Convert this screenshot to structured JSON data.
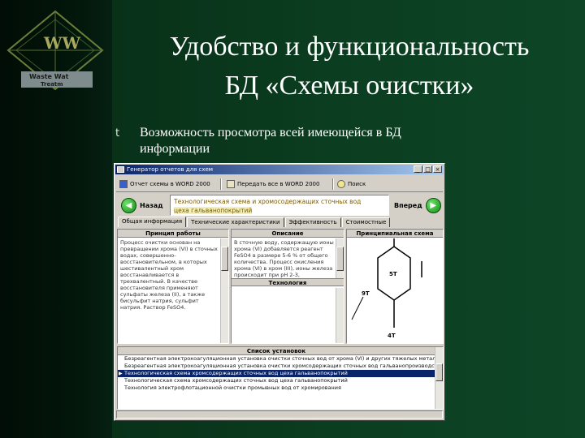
{
  "slide": {
    "title_line1": "Удобство и функциональность",
    "title_line2": "БД «Схемы очистки»",
    "bullet_symbol": "t",
    "bullet_line1": "Возможность просмотра всей имеющейся в БД",
    "bullet_line2": "информации"
  },
  "logo": {
    "text_line1": "Waste Wat",
    "text_line2": "Treatm",
    "letters": "WW"
  },
  "app": {
    "window_title": "Генератор отчетов для схем",
    "window_buttons": [
      "_",
      "□",
      "×"
    ],
    "toolbar": {
      "export_word": "Отчет схемы в WORD 2000",
      "send_word": "Передать все в WORD 2000",
      "search": "Поиск"
    },
    "nav": {
      "back": "Назад",
      "forward": "Вперед",
      "topic_line1": "Технологическая схема и хромосодержащих сточных вод",
      "topic_line2": "цеха гальванопокрытий"
    },
    "tabs": [
      "Общая информация",
      "Технические характеристики",
      "Эффективность",
      "Стоимостные"
    ],
    "columns": {
      "principle": "Принцип работы",
      "description": "Описание",
      "scheme": "Принципиальная схема",
      "technology": "Технология"
    },
    "principle_text": "Процесс очистки основан на превращении хрома (VI) в сточных водах, совершенно-восстановительном, в которых шестивалентный хром восстанавливается в трехвалентный. В качестве восстановителя применяют сульфаты железа (II), а также бисульфит натрия, сульфит натрия. Раствор FeSO4.",
    "description_text": "В сточную воду, содержащую ионы хрома (VI) добавляется реагент FeSO4 в размере 5-6 % от общего количества. Процесс окисления хрома (VI) в хром (III), ионы железа происходит при рН 2-3, восстанавливаясь до Cr(OH)3, что приводит к осаждению и обезвреживанию воды.",
    "scheme_labels": {
      "center": "5T",
      "left": "9T",
      "bottom": "4T"
    },
    "list_title": "Список установок",
    "list_items": [
      "Безреагентная электрокоагуляционная установка очистки сточных вод от хрома (VI) и других тяжелых металлов",
      "Безреагентная электрокоагуляционная установка очистки хромсодержащих сточных вод гальванопроизводства",
      "Технологическая схема хромсодержащих сточных вод цеха гальванопокрытий",
      "Технологическая схема хромсодержащих сточных вод цеха гальванопокрытий",
      "Технология электрофлотационной очистки промывных вод от хромирования"
    ],
    "selected_index": 2
  },
  "colors": {
    "slide_bg": "#0b3d20",
    "selection": "#0a246a",
    "window_face": "#d4d0c8",
    "title_bar": "#0a246a"
  }
}
